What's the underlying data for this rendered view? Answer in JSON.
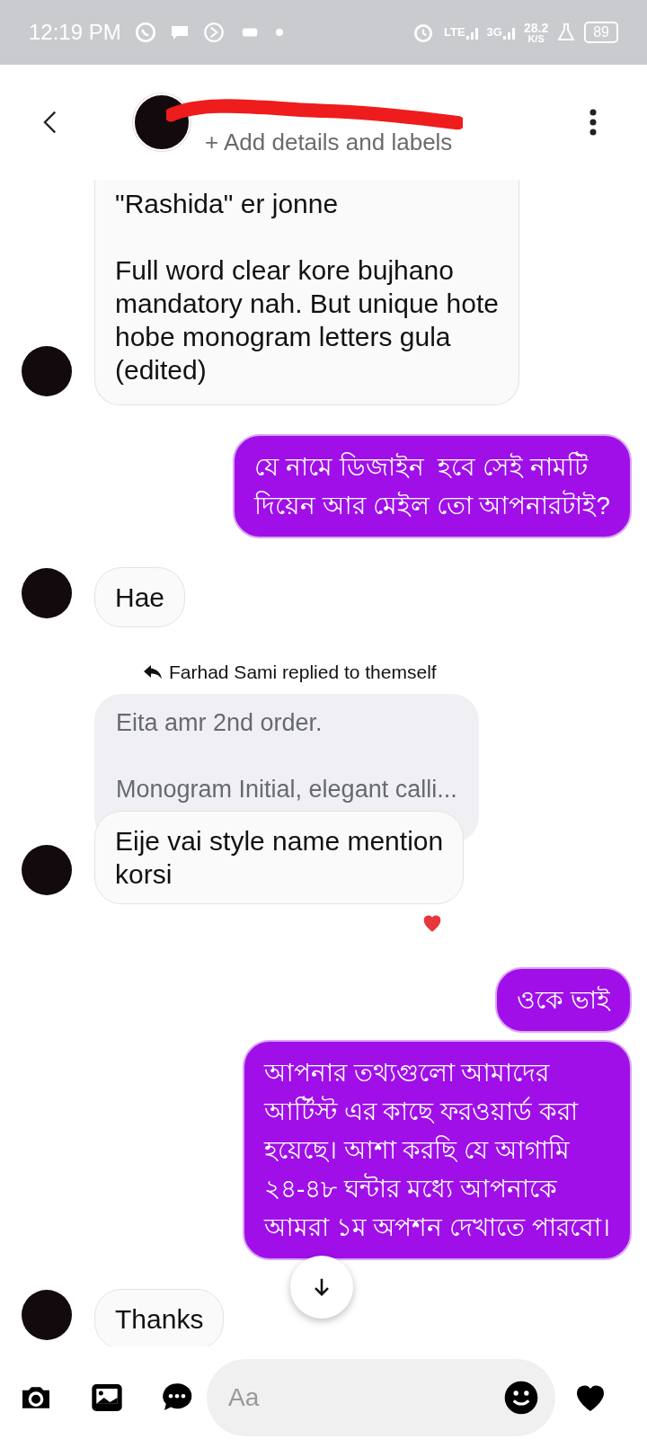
{
  "status_bar": {
    "time": "12:19 PM",
    "network_1": "LTE",
    "network_2": "3G",
    "speed": "28.2",
    "speed_unit": "K/S",
    "battery": "89"
  },
  "header": {
    "subtitle": "+ Add details and labels"
  },
  "messages": [
    {
      "kind": "received",
      "text": "\"Rashida\" er jonne\n\nFull word clear kore bujhano\nmandatory nah. But unique hote\nhobe monogram letters gula\n(edited)",
      "avatar": true,
      "cut_top": true
    },
    {
      "kind": "sent",
      "text": "যে নামে ডিজাইন  হবে সেই নামটি\nদিয়েন আর মেইল তো আপনারটাই?"
    },
    {
      "kind": "received",
      "text": "Hae",
      "avatar": true
    },
    {
      "kind": "reply_label",
      "text": "Farhad Sami replied to themself"
    },
    {
      "kind": "quoted",
      "text": "Eita amr 2nd order.\n\nMonogram Initial, elegant calli..."
    },
    {
      "kind": "received",
      "text": "Eije vai style name mention\nkorsi",
      "avatar": true,
      "reacted": true
    },
    {
      "kind": "sent",
      "text": "ওকে ভাই"
    },
    {
      "kind": "sent",
      "text": "আপনার তথ্যগুলো আমাদের\nআর্টিস্ট এর কাছে ফরওয়ার্ড করা\nহয়েছে। আশা করছি যে আগামি\n২৪-৪৮ ঘন্টার মধ্যে আপনাকে\nআমরা ১ম অপশন দেখাতে পারবো।"
    },
    {
      "kind": "received",
      "text": "Thanks",
      "avatar": true
    }
  ],
  "composer": {
    "placeholder": "Aa"
  }
}
